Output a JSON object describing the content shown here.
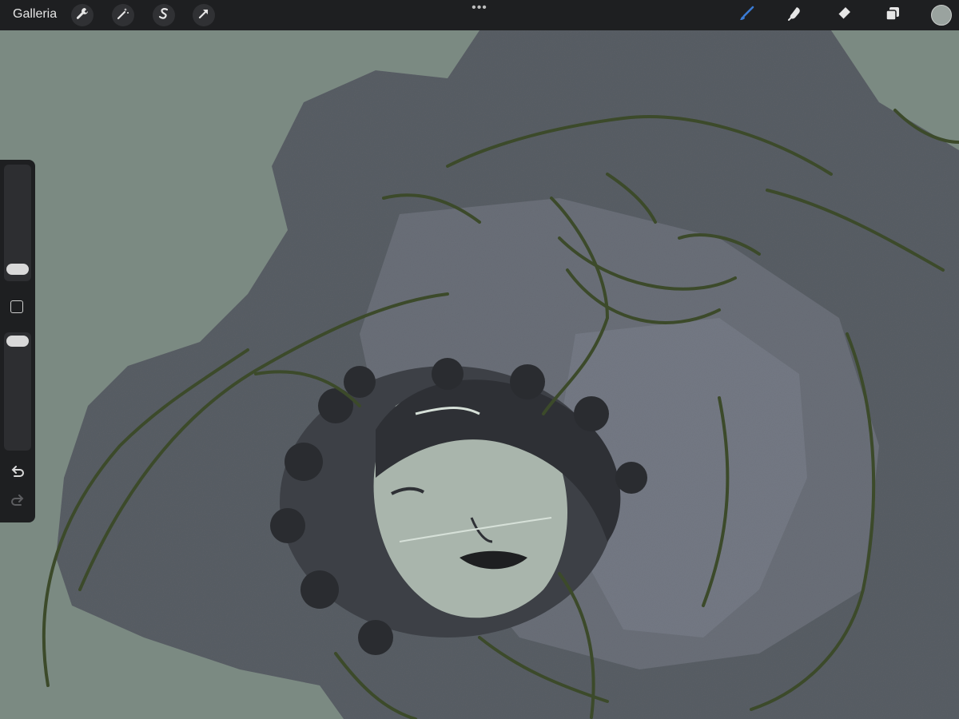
{
  "topbar": {
    "gallery_label": "Galleria",
    "more_menu": "•••",
    "left_tools": [
      "wrench-icon",
      "magic-wand-icon",
      "selection-s-icon",
      "transform-arrow-icon"
    ],
    "right_tools": [
      "brush-icon",
      "smudge-icon",
      "eraser-icon",
      "layers-icon"
    ],
    "current_color": "#9aa39f",
    "accent_color": "#3a7bd5"
  },
  "sidebar": {
    "brush_size_level": 0.36,
    "opacity_level": 0.05,
    "modify_button": "square-icon",
    "undo": "undo-icon",
    "redo": "redo-icon"
  },
  "canvas": {
    "background": "#7b8a82"
  }
}
